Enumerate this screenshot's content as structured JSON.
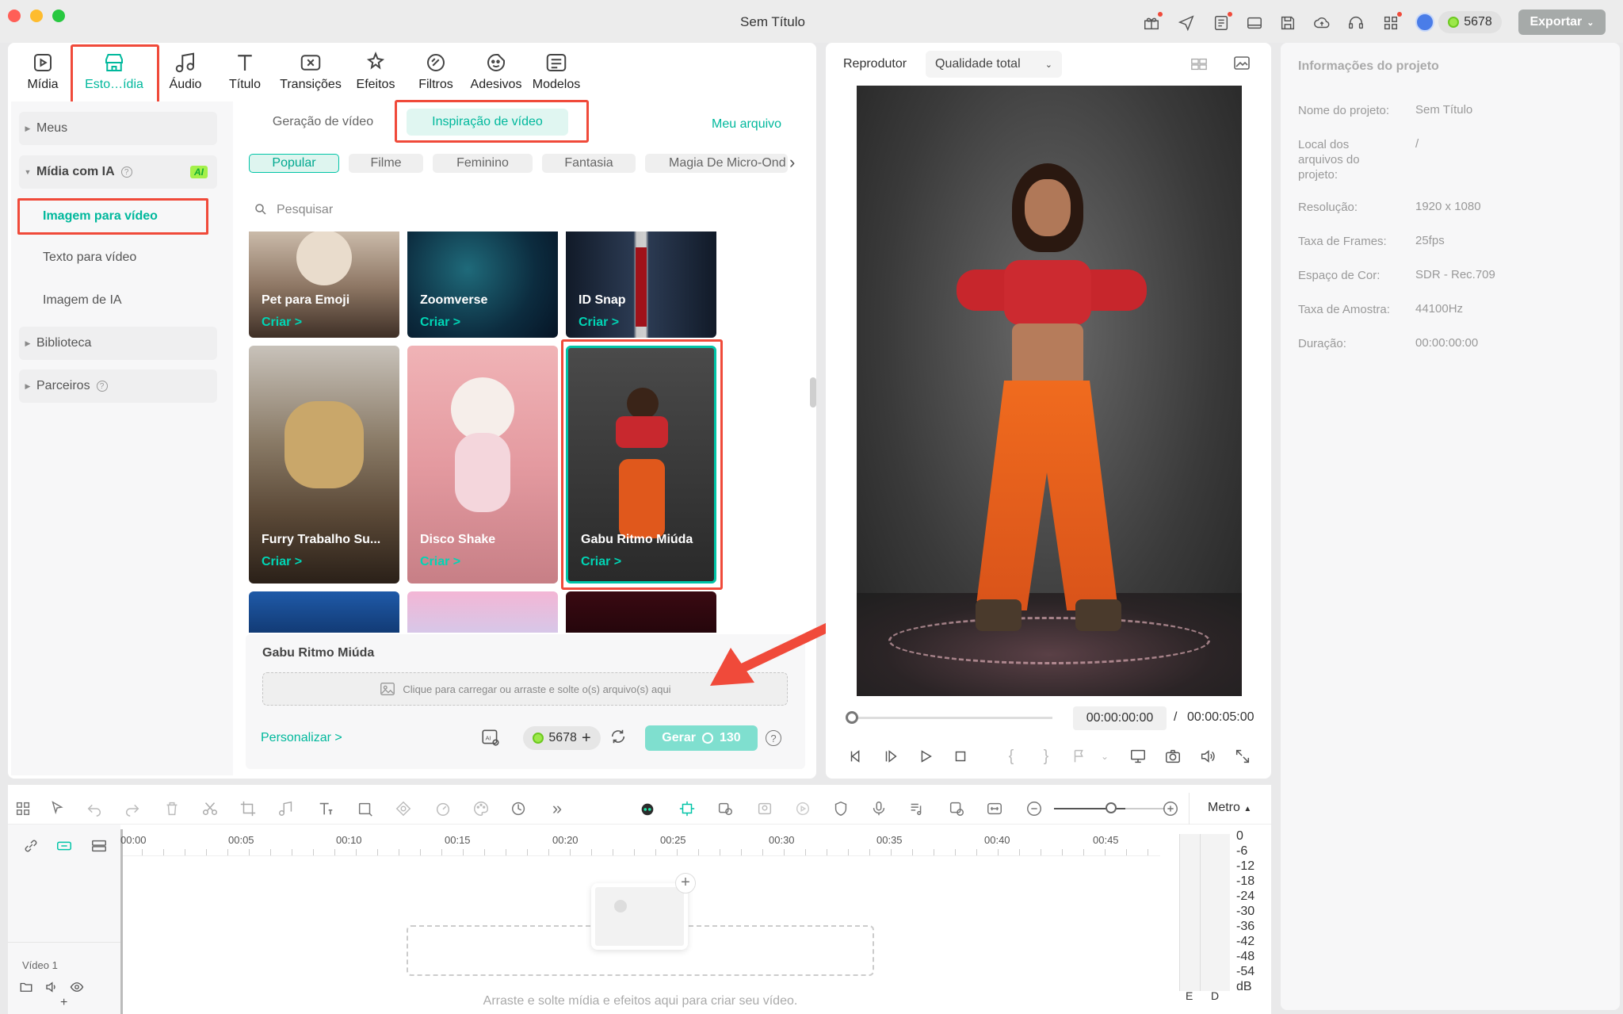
{
  "app": {
    "title": "Sem Título",
    "credits": "5678",
    "export_label": "Exportar"
  },
  "toolbar": {
    "items": [
      {
        "label": "Mídia"
      },
      {
        "label": "Esto…ídia"
      },
      {
        "label": "Áudio"
      },
      {
        "label": "Título"
      },
      {
        "label": "Transições"
      },
      {
        "label": "Efeitos"
      },
      {
        "label": "Filtros"
      },
      {
        "label": "Adesivos"
      },
      {
        "label": "Modelos"
      }
    ]
  },
  "sidebar": {
    "meus": "Meus",
    "midia_ia": "Mídia com IA",
    "ai_badge": "AI",
    "imagem_para_video": "Imagem para vídeo",
    "texto_para_video": "Texto para vídeo",
    "imagem_de_ia": "Imagem de IA",
    "biblioteca": "Biblioteca",
    "parceiros": "Parceiros"
  },
  "content": {
    "tab_geracao": "Geração de vídeo",
    "tab_inspiracao": "Inspiração de vídeo",
    "meu_arquivo": "Meu arquivo",
    "categories": [
      "Popular",
      "Filme",
      "Feminino",
      "Fantasia",
      "Magia De Micro-Ond"
    ],
    "search_placeholder": "Pesquisar",
    "cards": [
      {
        "name": "Pet para Emoji",
        "cta": "Criar >"
      },
      {
        "name": "Zoomverse",
        "cta": "Criar >"
      },
      {
        "name": "ID Snap",
        "cta": "Criar >"
      },
      {
        "name": "Furry Trabalho Su...",
        "cta": "Criar >"
      },
      {
        "name": "Disco Shake",
        "cta": "Criar >"
      },
      {
        "name": "Gabu Ritmo Miúda",
        "cta": "Criar >"
      }
    ],
    "selected_title": "Gabu Ritmo Miúda",
    "upload_text": "Clique para carregar ou arraste e solte o(s) arquivo(s) aqui",
    "personalizar": "Personalizar >",
    "credits": "5678",
    "gerar_label": "Gerar",
    "gerar_cost": "130"
  },
  "player": {
    "label": "Reprodutor",
    "quality": "Qualidade total",
    "current_time": "00:00:00:00",
    "separator": "/",
    "total_time": "00:00:05:00"
  },
  "project_info": {
    "title": "Informações do projeto",
    "rows": [
      {
        "label": "Nome do projeto:",
        "value": "Sem Título"
      },
      {
        "label": "Local dos arquivos do projeto:",
        "value": "/"
      },
      {
        "label": "Resolução:",
        "value": "1920 x 1080"
      },
      {
        "label": "Taxa de Frames:",
        "value": "25fps"
      },
      {
        "label": "Espaço de Cor:",
        "value": "SDR - Rec.709"
      },
      {
        "label": "Taxa de Amostra:",
        "value": "44100Hz"
      },
      {
        "label": "Duração:",
        "value": "00:00:00:00"
      }
    ]
  },
  "timeline": {
    "metro": "Metro",
    "ruler": [
      "00:00",
      "00:05",
      "00:10",
      "00:15",
      "00:20",
      "00:25",
      "00:30",
      "00:35",
      "00:40",
      "00:45"
    ],
    "track_label": "Vídeo 1",
    "drop_hint": "Arraste e solte mídia e efeitos aqui para criar seu vídeo.",
    "meter_scale": [
      "0",
      "-6",
      "-12",
      "-18",
      "-24",
      "-30",
      "-36",
      "-42",
      "-48",
      "-54",
      "dB"
    ],
    "meter_e": "E",
    "meter_d": "D"
  },
  "colors": {
    "accent": "#00c4a7",
    "highlight": "#f04a3a"
  }
}
